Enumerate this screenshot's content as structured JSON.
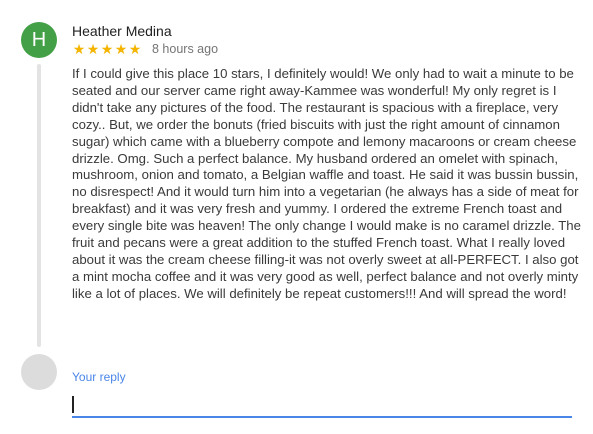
{
  "colors": {
    "avatar_bg": "#43a047",
    "star": "#f4b400",
    "accent": "#4a86e8"
  },
  "review": {
    "avatar_initial": "H",
    "reviewer_name": "Heather Medina",
    "rating": 5,
    "rating_max": 5,
    "star_icon": "★",
    "timestamp": "8 hours ago",
    "text": "If I could give this place 10 stars, I definitely would! We only had to wait a minute to be seated and our server came right away-Kammee was wonderful! My only regret is I didn't take any pictures of the food. The restaurant is spacious with a fireplace, very cozy.. But, we order the bonuts (fried biscuits with just the right amount of cinnamon sugar) which came with a blueberry compote and lemony macaroons or cream cheese drizzle. Omg. Such a perfect balance. My husband ordered an omelet with spinach, mushroom, onion and tomato, a Belgian waffle and toast. He said it was bussin bussin, no disrespect! And it would turn him into a vegetarian (he always has a side of meat for breakfast) and it was very fresh and yummy. I ordered the extreme French toast and every single bite was heaven! The only change I would make is no caramel drizzle. The fruit and pecans were a great addition to the stuffed French toast. What I really loved about it was the cream cheese filling-it was not overly sweet at all-PERFECT. I also got a mint mocha coffee and it was very good as well, perfect balance and not overly minty like a lot of places. We will definitely be repeat customers!!! And will spread the word!"
  },
  "reply": {
    "label": "Your reply",
    "value": ""
  }
}
